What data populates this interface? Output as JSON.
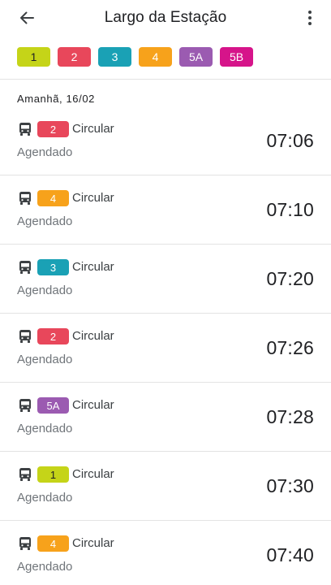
{
  "header": {
    "title": "Largo da Estação",
    "back_icon": "arrow-back-icon",
    "menu_icon": "more-vert-icon"
  },
  "filters": [
    {
      "label": "1",
      "bg": "#c5d418",
      "fg": "#202124"
    },
    {
      "label": "2",
      "bg": "#e8475b",
      "fg": "#ffffff"
    },
    {
      "label": "3",
      "bg": "#1aa1b5",
      "fg": "#ffffff"
    },
    {
      "label": "4",
      "bg": "#f7a21b",
      "fg": "#ffffff"
    },
    {
      "label": "5A",
      "bg": "#9b5bb1",
      "fg": "#ffffff"
    },
    {
      "label": "5B",
      "bg": "#d6148a",
      "fg": "#ffffff"
    }
  ],
  "date_header": "Amanhã, 16/02",
  "departures": [
    {
      "line": "2",
      "bg": "#e8475b",
      "fg": "#ffffff",
      "destination": "Circular",
      "status": "Agendado",
      "time": "07:06"
    },
    {
      "line": "4",
      "bg": "#f7a21b",
      "fg": "#ffffff",
      "destination": "Circular",
      "status": "Agendado",
      "time": "07:10"
    },
    {
      "line": "3",
      "bg": "#1aa1b5",
      "fg": "#ffffff",
      "destination": "Circular",
      "status": "Agendado",
      "time": "07:20"
    },
    {
      "line": "2",
      "bg": "#e8475b",
      "fg": "#ffffff",
      "destination": "Circular",
      "status": "Agendado",
      "time": "07:26"
    },
    {
      "line": "5A",
      "bg": "#9b5bb1",
      "fg": "#ffffff",
      "destination": "Circular",
      "status": "Agendado",
      "time": "07:28"
    },
    {
      "line": "1",
      "bg": "#c5d418",
      "fg": "#202124",
      "destination": "Circular",
      "status": "Agendado",
      "time": "07:30"
    },
    {
      "line": "4",
      "bg": "#f7a21b",
      "fg": "#ffffff",
      "destination": "Circular",
      "status": "Agendado",
      "time": "07:40"
    }
  ]
}
